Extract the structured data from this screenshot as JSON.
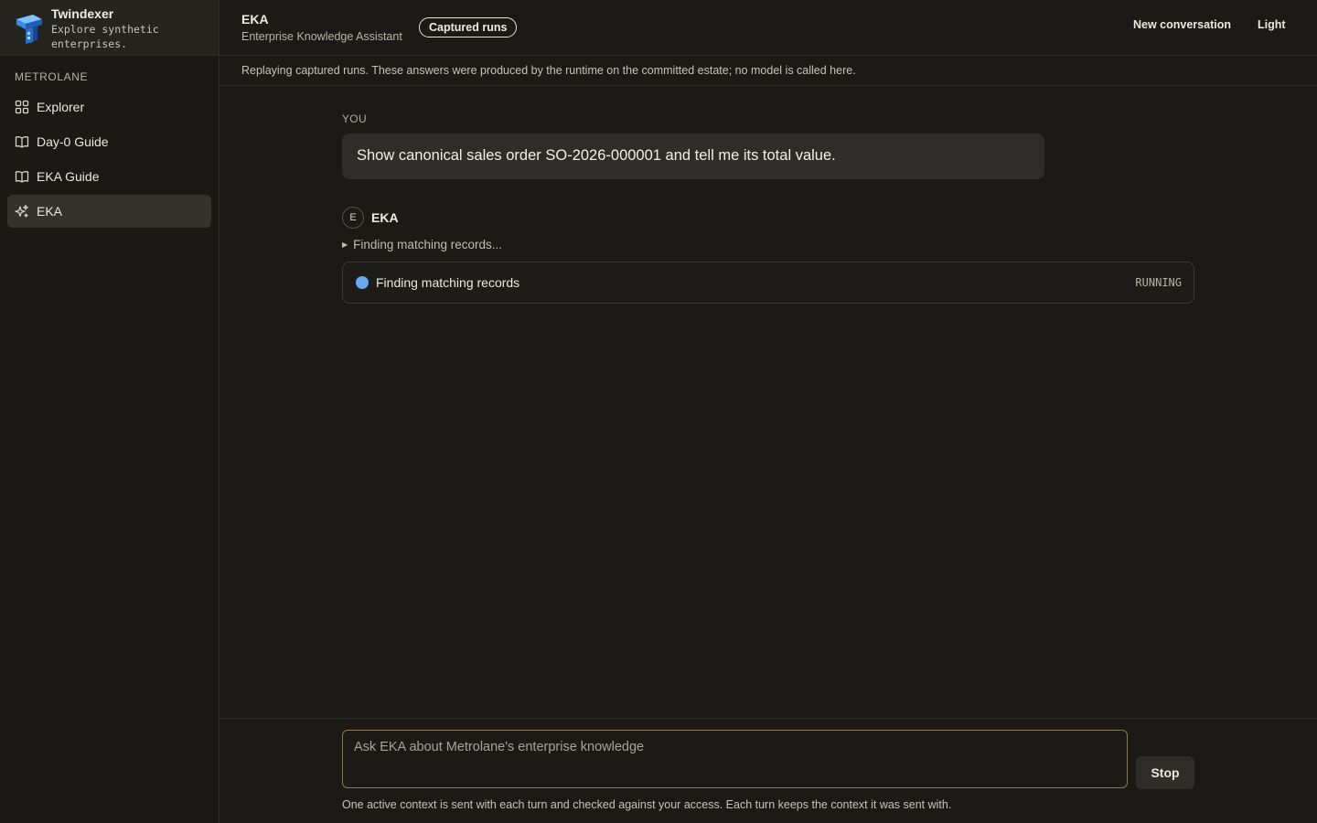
{
  "brand": {
    "name": "Twindexer",
    "tagline": "Explore synthetic enterprises."
  },
  "sidebar": {
    "section": "METROLANE",
    "items": [
      {
        "label": "Explorer",
        "icon": "grid-icon",
        "active": false
      },
      {
        "label": "Day-0 Guide",
        "icon": "book-icon",
        "active": false
      },
      {
        "label": "EKA Guide",
        "icon": "book-icon",
        "active": false
      },
      {
        "label": "EKA",
        "icon": "sparkle-icon",
        "active": true
      }
    ]
  },
  "header": {
    "title": "EKA",
    "subtitle": "Enterprise Knowledge Assistant",
    "badge": "Captured runs",
    "new_conversation": "New conversation",
    "theme_toggle": "Light"
  },
  "notice": "Replaying captured runs. These answers were produced by the runtime on the committed estate; no model is called here.",
  "conversation": {
    "user_label": "YOU",
    "user_message": "Show canonical sales order SO-2026-000001 and tell me its total value.",
    "assistant": {
      "avatar": "E",
      "name": "EKA",
      "disclosure": "Finding matching records...",
      "step": {
        "label": "Finding matching records",
        "state": "RUNNING",
        "dot_color": "#6aa8f0"
      }
    }
  },
  "composer": {
    "placeholder": "Ask EKA about Metrolane's enterprise knowledge",
    "value": "",
    "stop_label": "Stop",
    "note": "One active context is sent with each turn and checked against your access. Each turn keeps the context it was sent with."
  },
  "colors": {
    "background": "#1b1a17",
    "accent_border": "#8c7a5e",
    "running_dot": "#6aa8f0"
  }
}
